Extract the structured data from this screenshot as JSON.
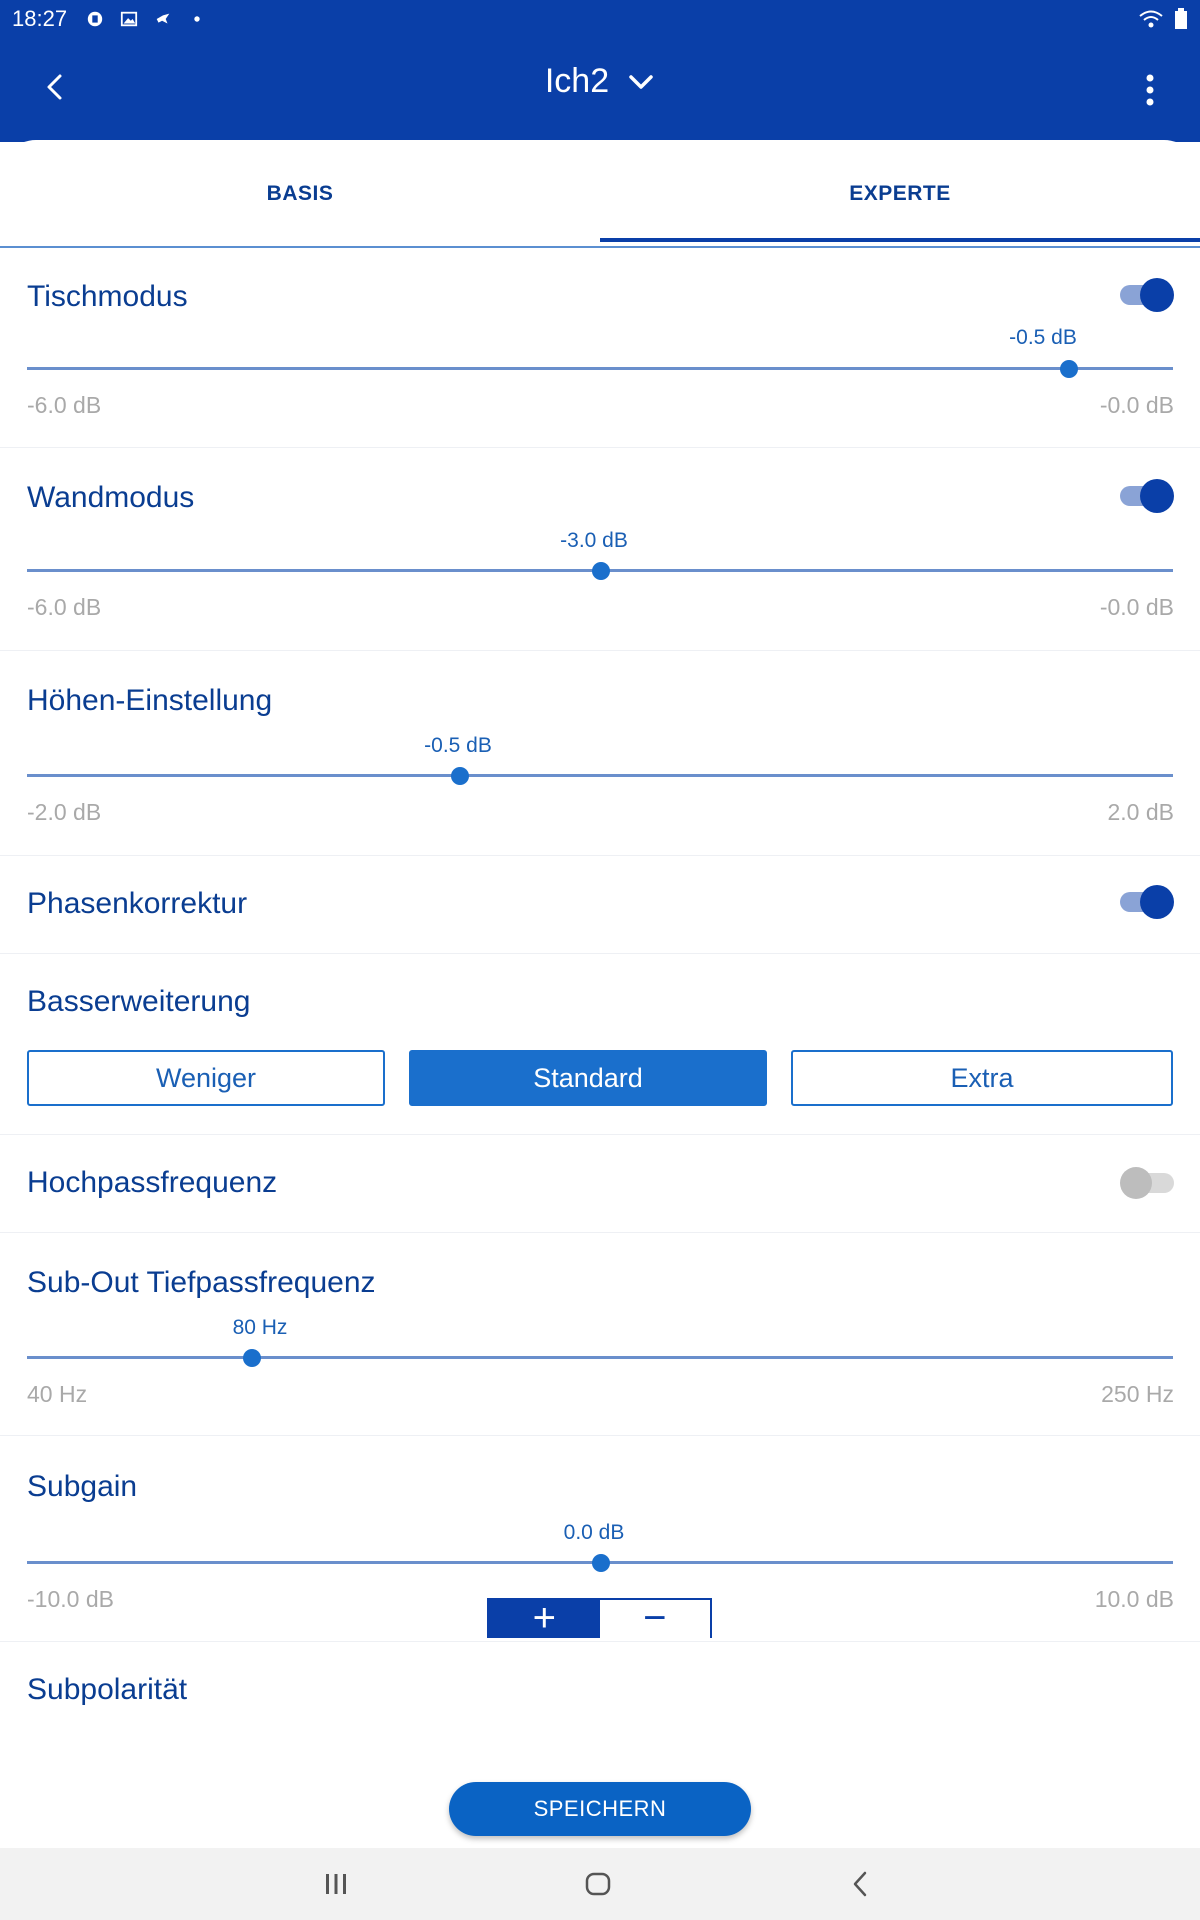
{
  "status_bar": {
    "time": "18:27"
  },
  "header": {
    "title": "Ich2"
  },
  "tabs": [
    {
      "label": "BASIS",
      "active": false
    },
    {
      "label": "EXPERTE",
      "active": true
    }
  ],
  "sections": {
    "tischmodus": {
      "title": "Tischmodus",
      "toggle_on": true,
      "value_label": "-0.5 dB",
      "min_label": "-6.0 dB",
      "max_label": "-0.0 dB",
      "position": 0.91
    },
    "wandmodus": {
      "title": "Wandmodus",
      "toggle_on": true,
      "value_label": "-3.0 dB",
      "min_label": "-6.0 dB",
      "max_label": "-0.0 dB",
      "position": 0.5
    },
    "hoehen": {
      "title": "Höhen-Einstellung",
      "value_label": "-0.5 dB",
      "min_label": "-2.0 dB",
      "max_label": "2.0 dB",
      "position": 0.375
    },
    "phasenkorrektur": {
      "title": "Phasenkorrektur",
      "toggle_on": true
    },
    "basserweiterung": {
      "title": "Basserweiterung",
      "options": [
        "Weniger",
        "Standard",
        "Extra"
      ],
      "selected": "Standard"
    },
    "hochpass": {
      "title": "Hochpassfrequenz",
      "toggle_on": false
    },
    "subout": {
      "title": "Sub-Out Tiefpassfrequenz",
      "value_label": "80 Hz",
      "min_label": "40 Hz",
      "max_label": "250 Hz",
      "position": 0.19
    },
    "subgain": {
      "title": "Subgain",
      "value_label": "0.0 dB",
      "min_label": "-10.0 dB",
      "max_label": "10.0 dB",
      "position": 0.5
    },
    "subpolaritaet": {
      "title": "Subpolarität",
      "plus": "+",
      "minus": "−",
      "selected": "+"
    }
  },
  "save_button": {
    "label": "SPEICHERN"
  },
  "icons": {
    "back": "chevron-left-icon",
    "title_dropdown": "chevron-down-icon",
    "menu": "more-vert-icon",
    "nav_recents": "recents-icon",
    "nav_home": "home-icon",
    "nav_back": "nav-back-icon"
  },
  "colors": {
    "primary": "#0a3fa8",
    "accent": "#1a6fcc",
    "muted": "#a9a9a9"
  }
}
